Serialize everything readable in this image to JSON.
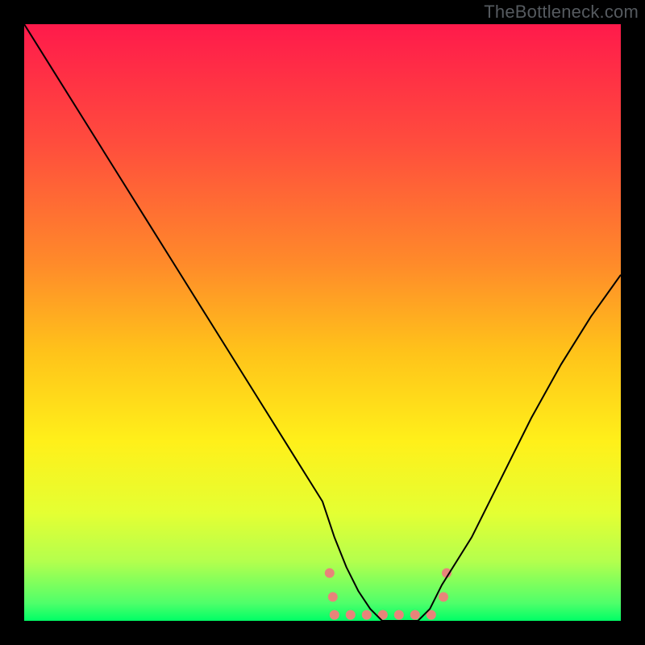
{
  "watermark": "TheBottleneck.com",
  "chart_data": {
    "type": "line",
    "title": "",
    "xlabel": "",
    "ylabel": "",
    "xlim": [
      0,
      100
    ],
    "ylim": [
      0,
      100
    ],
    "grid": false,
    "legend": false,
    "x": [
      0,
      5,
      10,
      15,
      20,
      25,
      30,
      35,
      40,
      45,
      50,
      52,
      54,
      56,
      58,
      60,
      62,
      64,
      66,
      68,
      70,
      75,
      80,
      85,
      90,
      95,
      100
    ],
    "curve_percent": [
      100,
      92,
      84,
      76,
      68,
      60,
      52,
      44,
      36,
      28,
      20,
      14,
      9,
      5,
      2,
      0,
      0,
      0,
      0,
      2,
      6,
      14,
      24,
      34,
      43,
      51,
      58
    ],
    "marker_zone": {
      "x_start": 52,
      "x_end": 70,
      "y": 1
    },
    "background_gradient": {
      "stops": [
        {
          "pos": 0.0,
          "color": "#ff1a4b"
        },
        {
          "pos": 0.2,
          "color": "#ff4d3d"
        },
        {
          "pos": 0.4,
          "color": "#ff8a2a"
        },
        {
          "pos": 0.55,
          "color": "#ffc31a"
        },
        {
          "pos": 0.7,
          "color": "#fff01a"
        },
        {
          "pos": 0.82,
          "color": "#e4ff33"
        },
        {
          "pos": 0.9,
          "color": "#b4ff4d"
        },
        {
          "pos": 0.97,
          "color": "#50ff6a"
        },
        {
          "pos": 1.0,
          "color": "#00ff66"
        }
      ]
    },
    "marker_color": "#e8847a",
    "curve_color": "#000000"
  }
}
